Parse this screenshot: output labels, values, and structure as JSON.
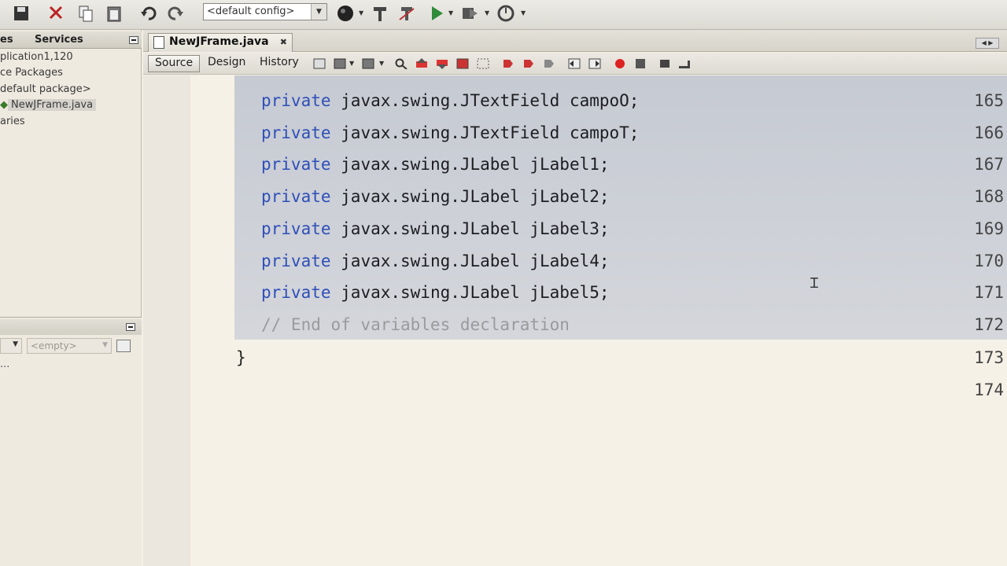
{
  "toolbar": {
    "config_value": "<default config>",
    "icons": [
      "save-all-icon",
      "cut-icon",
      "copy-icon",
      "paste-icon",
      "undo-icon",
      "redo-icon",
      "globe-icon",
      "build-icon",
      "clean-build-icon",
      "run-icon",
      "debug-icon",
      "profile-icon"
    ]
  },
  "left_panel": {
    "tabs": [
      "es",
      "Services"
    ],
    "tree": [
      "plication1,120",
      "ce Packages",
      "default package>",
      "NewJFrame.java",
      "aries"
    ],
    "nav_empty": "<empty>",
    "nav_dots": "..."
  },
  "editor": {
    "file_tab": "NewJFrame.java",
    "views": [
      "Source",
      "Design",
      "History"
    ],
    "lines": [
      {
        "no": "165",
        "kw": "private",
        "rest": " javax.swing.JTextField campoO;"
      },
      {
        "no": "166",
        "kw": "private",
        "rest": " javax.swing.JTextField campoT;"
      },
      {
        "no": "167",
        "kw": "private",
        "rest": " javax.swing.JLabel jLabel1;"
      },
      {
        "no": "168",
        "kw": "private",
        "rest": " javax.swing.JLabel jLabel2;"
      },
      {
        "no": "169",
        "kw": "private",
        "rest": " javax.swing.JLabel jLabel3;"
      },
      {
        "no": "170",
        "kw": "private",
        "rest": " javax.swing.JLabel jLabel4;"
      },
      {
        "no": "171",
        "kw": "private",
        "rest": " javax.swing.JLabel jLabel5;"
      }
    ],
    "comment_line": {
      "no": "172",
      "text": "// End of variables declaration"
    },
    "brace_line": {
      "no": "173",
      "text": "}"
    },
    "empty_line": {
      "no": "174"
    }
  },
  "colors": {
    "keyword": "#2e4fb8",
    "comment": "#9a9a9e",
    "selection": "#c6cad3"
  }
}
